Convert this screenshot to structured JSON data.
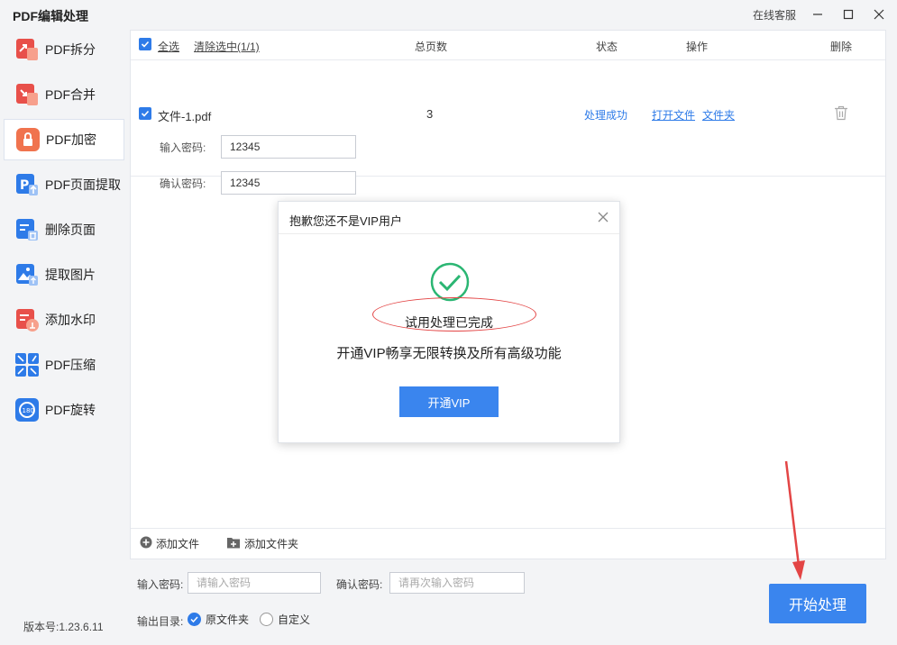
{
  "window": {
    "title": "PDF编辑处理",
    "support_label": "在线客服"
  },
  "sidebar": {
    "items": [
      {
        "label": "PDF拆分",
        "icon": "split-icon",
        "color": "#e8504a"
      },
      {
        "label": "PDF合并",
        "icon": "merge-icon",
        "color": "#e8504a"
      },
      {
        "label": "PDF加密",
        "icon": "lock-icon",
        "color": "#f0734e"
      },
      {
        "label": "PDF页面提取",
        "icon": "page-extract-icon",
        "color": "#2e7be8"
      },
      {
        "label": "删除页面",
        "icon": "delete-page-icon",
        "color": "#2e7be8"
      },
      {
        "label": "提取图片",
        "icon": "image-extract-icon",
        "color": "#2e7be8"
      },
      {
        "label": "添加水印",
        "icon": "watermark-icon",
        "color": "#e8504a"
      },
      {
        "label": "PDF压缩",
        "icon": "compress-icon",
        "color": "#2e7be8"
      },
      {
        "label": "PDF旋转",
        "icon": "rotate-icon",
        "color": "#2e7be8"
      }
    ],
    "active_index": 2,
    "version": "版本号:1.23.6.11"
  },
  "table": {
    "select_all": "全选",
    "clear_selected": "清除选中(1/1)",
    "col_pages": "总页数",
    "col_status": "状态",
    "col_action": "操作",
    "col_delete": "删除"
  },
  "file": {
    "name": "文件-1.pdf",
    "pages": "3",
    "status": "处理成功",
    "open_file": "打开文件",
    "open_folder": "文件夹",
    "pw_label": "输入密码:",
    "pw_value": "12345",
    "confirm_label": "确认密码:",
    "confirm_value": "12345"
  },
  "footer": {
    "add_file": "添加文件",
    "add_folder": "添加文件夹"
  },
  "bottom_form": {
    "pw_label": "输入密码:",
    "pw_placeholder": "请输入密码",
    "confirm_label": "确认密码:",
    "confirm_placeholder": "请再次输入密码",
    "output_label": "输出目录:",
    "opt_original": "原文件夹",
    "opt_custom": "自定义"
  },
  "start_button": "开始处理",
  "dialog": {
    "title": "抱歉您还不是VIP用户",
    "done": "试用处理已完成",
    "promo": "开通VIP畅享无限转换及所有高级功能",
    "vip_button": "开通VIP"
  },
  "colors": {
    "accent": "#2e7be8",
    "success": "#2bb673",
    "annotation": "#e34545"
  }
}
